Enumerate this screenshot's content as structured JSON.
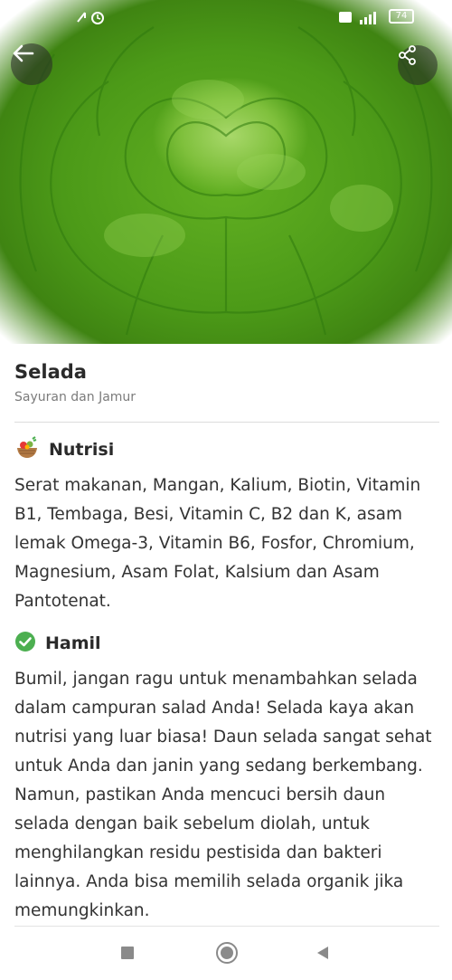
{
  "status_bar": {
    "battery": "74"
  },
  "item": {
    "title": "Selada",
    "category": "Sayuran dan Jamur"
  },
  "sections": {
    "nutrisi": {
      "heading": "Nutrisi",
      "icon": "food-basket-icon",
      "text": "Serat makanan, Mangan, Kalium, Biotin, Vitamin B1, Tembaga, Besi, Vitamin C, B2 dan K, asam lemak Omega-3, Vitamin B6, Fosfor, Chromium, Magnesium, Asam Folat, Kalsium dan Asam Pantotenat."
    },
    "hamil": {
      "heading": "Hamil",
      "icon": "check-circle-icon",
      "icon_color": "#4caf50",
      "text": "Bumil, jangan ragu untuk menambahkan selada dalam campuran salad Anda! Selada kaya akan nutrisi yang luar biasa! Daun selada sangat sehat untuk Anda dan janin yang sedang berkembang. Namun, pastikan Anda mencuci bersih daun selada dengan baik sebelum diolah, untuk menghilangkan residu pestisida dan bakteri lainnya. Anda bisa memilih selada organik jika memungkinkan."
    }
  },
  "header": {
    "back_icon": "back-arrow-icon",
    "share_icon": "share-icon"
  },
  "navbar": {
    "recents_icon": "square-icon",
    "home_icon": "home-circle-icon",
    "back_icon": "triangle-back-icon"
  }
}
